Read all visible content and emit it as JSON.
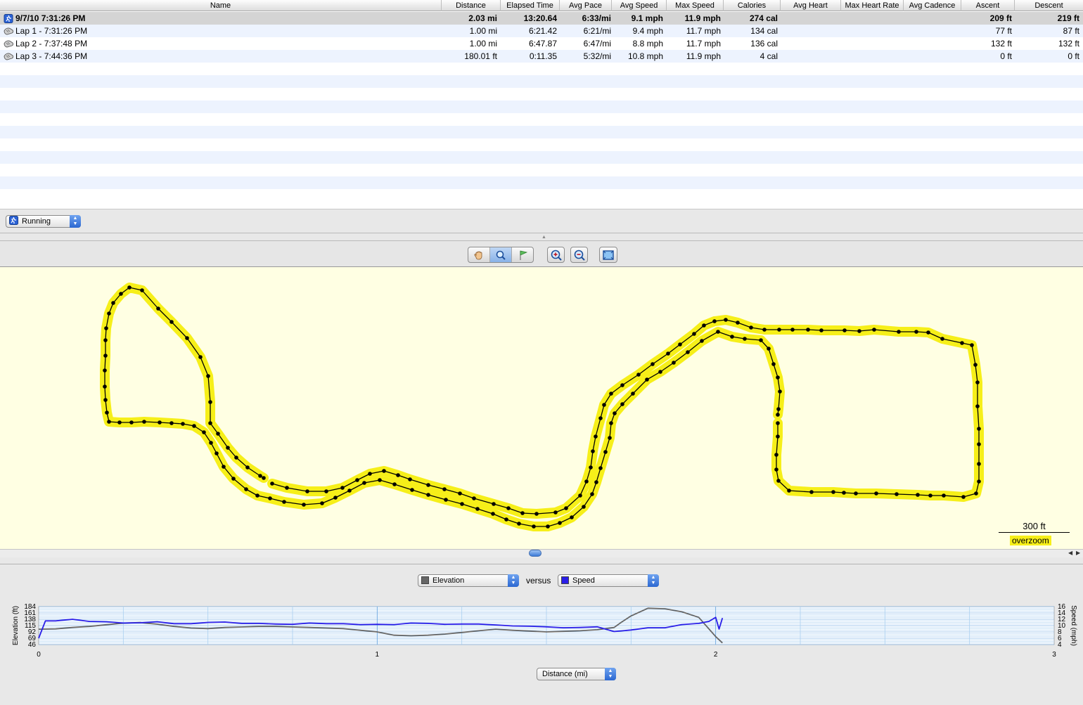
{
  "table": {
    "columns": [
      "Name",
      "Distance",
      "Elapsed Time",
      "Avg Pace",
      "Avg Speed",
      "Max Speed",
      "Calories",
      "Avg Heart",
      "Max Heart Rate",
      "Avg Cadence",
      "Ascent",
      "Descent"
    ],
    "rows": [
      {
        "name": "9/7/10 7:31:26 PM",
        "distance": "2.03 mi",
        "elapsed": "13:20.64",
        "pace": "6:33/mi",
        "avg_speed": "9.1 mph",
        "max_speed": "11.9 mph",
        "calories": "274 cal",
        "avg_heart": "",
        "max_heart": "",
        "cadence": "",
        "ascent": "209 ft",
        "descent": "219 ft",
        "icon": "running-activity-icon"
      },
      {
        "name": "Lap 1 - 7:31:26 PM",
        "distance": "1.00 mi",
        "elapsed": "6:21.42",
        "pace": "6:21/mi",
        "avg_speed": "9.4 mph",
        "max_speed": "11.7 mph",
        "calories": "134 cal",
        "avg_heart": "",
        "max_heart": "",
        "cadence": "",
        "ascent": "77 ft",
        "descent": "87 ft",
        "icon": "lap-shoe-icon"
      },
      {
        "name": "Lap 2 - 7:37:48 PM",
        "distance": "1.00 mi",
        "elapsed": "6:47.87",
        "pace": "6:47/mi",
        "avg_speed": "8.8 mph",
        "max_speed": "11.7 mph",
        "calories": "136 cal",
        "avg_heart": "",
        "max_heart": "",
        "cadence": "",
        "ascent": "132 ft",
        "descent": "132 ft",
        "icon": "lap-shoe-icon"
      },
      {
        "name": "Lap 3 - 7:44:36 PM",
        "distance": "180.01 ft",
        "elapsed": "0:11.35",
        "pace": "5:32/mi",
        "avg_speed": "10.8 mph",
        "max_speed": "11.9 mph",
        "calories": "4 cal",
        "avg_heart": "",
        "max_heart": "",
        "cadence": "",
        "ascent": "0 ft",
        "descent": "0 ft",
        "icon": "lap-shoe-icon"
      }
    ]
  },
  "activity_selector": {
    "value": "Running",
    "icon": "running-activity-icon"
  },
  "map_toolbar": {
    "tools": [
      "hand-tool-icon",
      "zoom-tool-icon",
      "flag-tool-icon"
    ],
    "zoom_in": "zoom-in-icon",
    "zoom_out": "zoom-out-icon",
    "fit": "fit-to-window-icon"
  },
  "map": {
    "scale_label": "300 ft",
    "overzoom_label": "overzoom",
    "route_color": "#f6ef19"
  },
  "graph": {
    "left_metric": "Elevation",
    "versus_label": "versus",
    "right_metric": "Speed",
    "left_color": "#666666",
    "right_color": "#2a1ee8",
    "x_axis_selector": "Distance (mi)",
    "left_axis_label": "Elevation (ft)",
    "right_axis_label": "Speed (mph)",
    "left_ticks": [
      "184",
      "161",
      "138",
      "115",
      "92",
      "69",
      "46"
    ],
    "right_ticks": [
      "16",
      "14",
      "12",
      "10",
      "8",
      "6",
      "4"
    ],
    "x_ticks": [
      "0",
      "1",
      "2",
      "3"
    ]
  },
  "chart_data": {
    "type": "line",
    "xlabel": "Distance (mi)",
    "ylabel": "Elevation (ft)",
    "y2label": "Speed (mph)",
    "xlim": [
      0,
      3
    ],
    "ylim": [
      46,
      184
    ],
    "y2lim": [
      4,
      16
    ],
    "grid": true,
    "series": [
      {
        "name": "Elevation",
        "axis": "left",
        "x": [
          0,
          0.05,
          0.1,
          0.15,
          0.2,
          0.25,
          0.3,
          0.35,
          0.4,
          0.45,
          0.5,
          0.55,
          0.6,
          0.65,
          0.7,
          0.75,
          0.8,
          0.85,
          0.9,
          0.95,
          1.0,
          1.05,
          1.1,
          1.15,
          1.2,
          1.25,
          1.3,
          1.35,
          1.4,
          1.45,
          1.5,
          1.55,
          1.6,
          1.65,
          1.7,
          1.72,
          1.75,
          1.8,
          1.85,
          1.9,
          1.95,
          2.0,
          2.02
        ],
        "values": [
          102,
          103,
          108,
          112,
          118,
          124,
          126,
          120,
          112,
          106,
          104,
          108,
          110,
          112,
          112,
          110,
          108,
          106,
          104,
          98,
          92,
          80,
          78,
          80,
          84,
          90,
          96,
          102,
          98,
          95,
          92,
          94,
          96,
          100,
          108,
          126,
          150,
          178,
          176,
          165,
          145,
          75,
          52
        ]
      },
      {
        "name": "Speed",
        "axis": "right",
        "x": [
          0,
          0.02,
          0.05,
          0.1,
          0.15,
          0.2,
          0.25,
          0.3,
          0.35,
          0.4,
          0.45,
          0.5,
          0.55,
          0.6,
          0.65,
          0.7,
          0.75,
          0.8,
          0.85,
          0.9,
          0.95,
          1.0,
          1.05,
          1.1,
          1.15,
          1.2,
          1.25,
          1.3,
          1.35,
          1.4,
          1.45,
          1.5,
          1.55,
          1.6,
          1.65,
          1.7,
          1.75,
          1.8,
          1.85,
          1.9,
          1.95,
          1.98,
          2.0,
          2.01,
          2.02
        ],
        "values": [
          6,
          11.5,
          11.5,
          12,
          11.3,
          11.2,
          10.8,
          10.9,
          11.2,
          10.6,
          10.6,
          11,
          11.1,
          10.7,
          10.7,
          10.5,
          10.4,
          10.8,
          10.6,
          10.6,
          10.3,
          10.4,
          10.3,
          10.8,
          10.7,
          10.4,
          10.5,
          10.5,
          10.2,
          9.9,
          9.8,
          9.6,
          9.3,
          9.4,
          9.6,
          8.1,
          8.6,
          9.3,
          9.3,
          10.3,
          10.7,
          11.3,
          12.6,
          8.9,
          12.4
        ]
      }
    ]
  }
}
